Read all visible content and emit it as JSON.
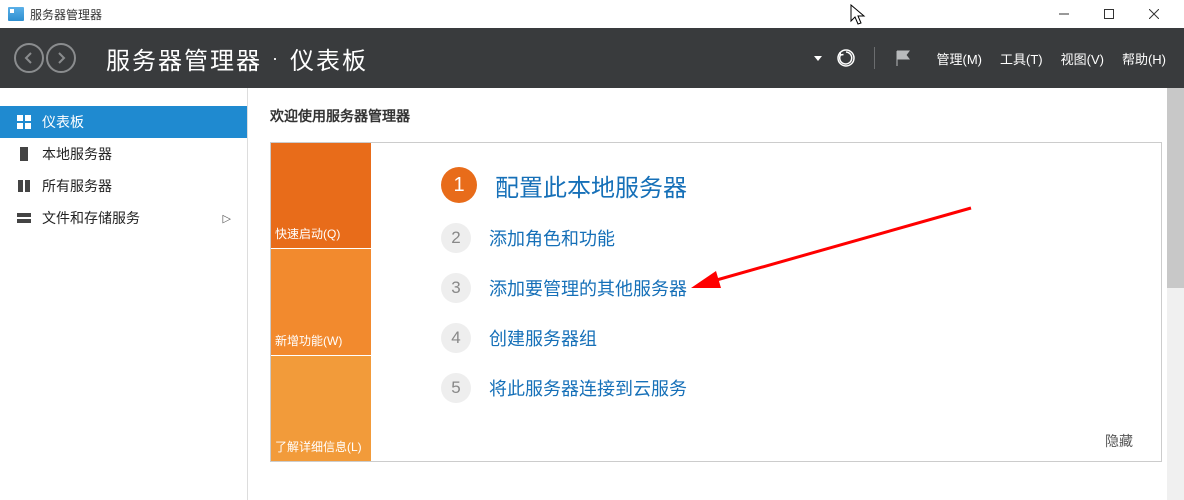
{
  "titlebar": {
    "app_title": "服务器管理器"
  },
  "header": {
    "breadcrumb_app": "服务器管理器",
    "breadcrumb_page": "仪表板",
    "menu": {
      "manage": "管理(M)",
      "tools": "工具(T)",
      "view": "视图(V)",
      "help": "帮助(H)"
    }
  },
  "sidebar": {
    "items": [
      {
        "label": "仪表板"
      },
      {
        "label": "本地服务器"
      },
      {
        "label": "所有服务器"
      },
      {
        "label": "文件和存储服务"
      }
    ]
  },
  "content": {
    "welcome_title": "欢迎使用服务器管理器",
    "left_stack": {
      "quickstart": "快速启动(Q)",
      "whatsnew": "新增功能(W)",
      "learnmore": "了解详细信息(L)"
    },
    "steps": [
      {
        "num": "1",
        "label": "配置此本地服务器"
      },
      {
        "num": "2",
        "label": "添加角色和功能"
      },
      {
        "num": "3",
        "label": "添加要管理的其他服务器"
      },
      {
        "num": "4",
        "label": "创建服务器组"
      },
      {
        "num": "5",
        "label": "将此服务器连接到云服务"
      }
    ],
    "hide": "隐藏"
  }
}
